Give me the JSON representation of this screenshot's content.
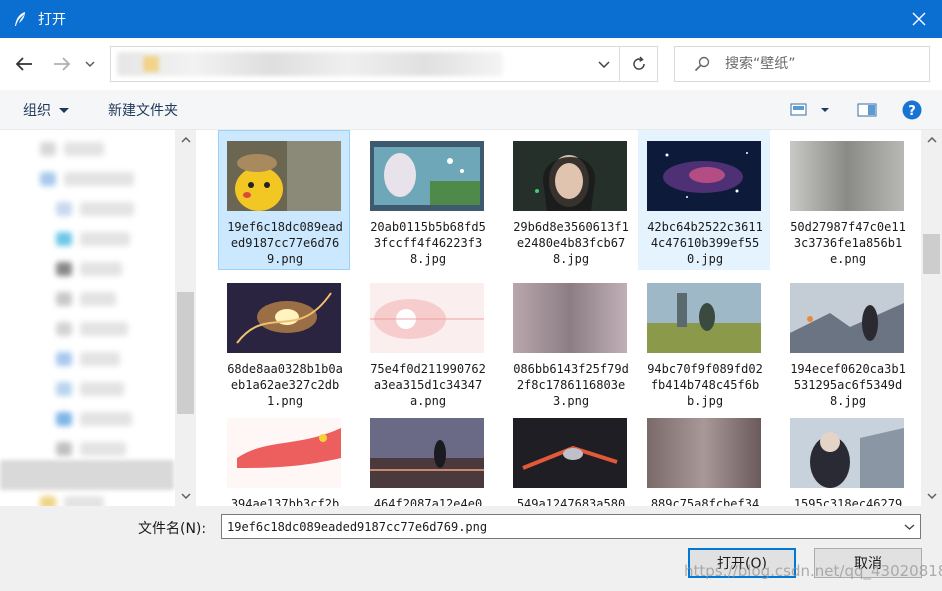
{
  "window": {
    "title": "打开"
  },
  "address": {
    "search_placeholder": "搜索“壁纸”"
  },
  "toolbar": {
    "organize_label": "组织",
    "new_folder_label": "新建文件夹"
  },
  "files": [
    {
      "name": "19ef6c18dc089eaded9187cc77e6d769.png",
      "state": "selected",
      "thumb": "pikachu"
    },
    {
      "name": "20ab0115b5b68fd53fccff4f46223f38.jpg",
      "state": "",
      "thumb": "aquarium"
    },
    {
      "name": "29b6d8e3560613f1e2480e4b83fcb678.jpg",
      "state": "",
      "thumb": "girl"
    },
    {
      "name": "42bc64b2522c36114c47610b399ef550.jpg",
      "state": "hover",
      "thumb": "galaxy"
    },
    {
      "name": "50d27987f47c0e113c3736fe1a856b1e.png",
      "state": "",
      "thumb": "blurgray"
    },
    {
      "name": "68de8aa0328b1b0aeb1a62ae327c2db1.png",
      "state": "",
      "thumb": "fire"
    },
    {
      "name": "75e4f0d211990762a3ea315d1c34347a.png",
      "state": "",
      "thumb": "pink"
    },
    {
      "name": "086bb6143f25f79d2f8c1786116803e3.png",
      "state": "",
      "thumb": "blurmauve"
    },
    {
      "name": "94bc70f9f089fd02fb414b748c45f6bb.jpg",
      "state": "",
      "thumb": "field"
    },
    {
      "name": "194ecef0620ca3b1531295ac6f5349d8.jpg",
      "state": "",
      "thumb": "snowcastle"
    },
    {
      "name": "394ae137bb3cf2b",
      "state": "",
      "thumb": "flag"
    },
    {
      "name": "464f2087a12e4e0",
      "state": "",
      "thumb": "dusk"
    },
    {
      "name": "549a1247683a580",
      "state": "",
      "thumb": "dark"
    },
    {
      "name": "889c75a8fcbef34",
      "state": "",
      "thumb": "blurbrown"
    },
    {
      "name": "1595c318ec46279",
      "state": "",
      "thumb": "winter"
    }
  ],
  "bottom": {
    "filename_label": "文件名(N):",
    "filename_value": "19ef6c18dc089eaded9187cc77e6d769.png",
    "open_label": "打开(O)",
    "cancel_label": "取消",
    "watermark": "https://blog.csdn.net/qq_43020818"
  },
  "colors": {
    "titlebar": "#0a6fd1",
    "selected_bg": "#cce8ff",
    "primary_border": "#0078d7"
  },
  "icons": [
    "feather-icon",
    "close-icon",
    "back-arrow-icon",
    "forward-arrow-icon",
    "recent-chevron-icon",
    "chevron-down-icon",
    "refresh-icon",
    "search-icon",
    "view-options-icon",
    "preview-pane-icon",
    "help-icon"
  ]
}
